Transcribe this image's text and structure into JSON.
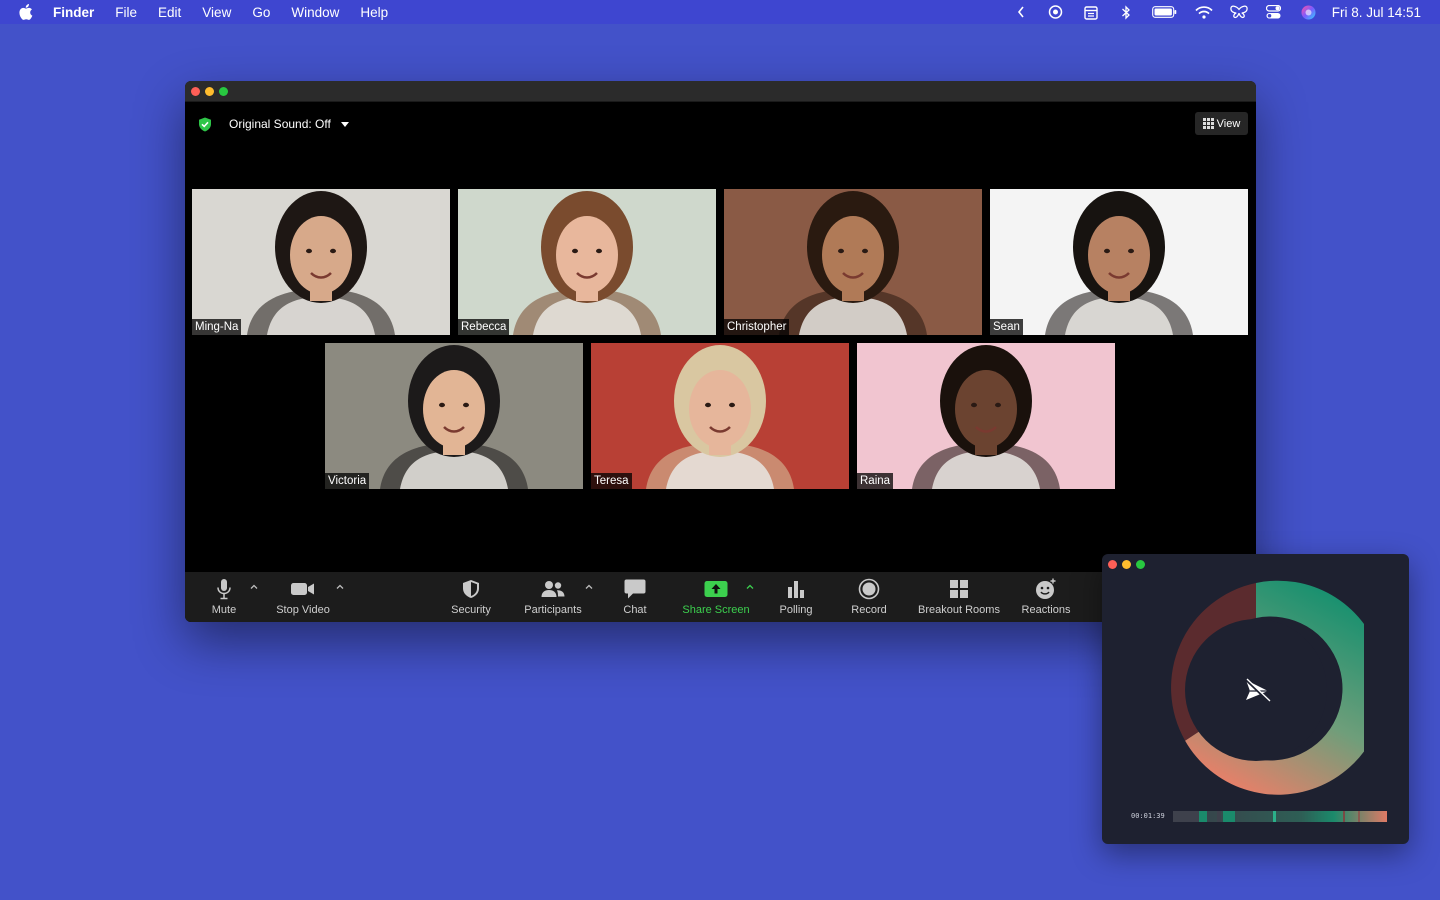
{
  "menubar": {
    "app_name": "Finder",
    "items": [
      "File",
      "Edit",
      "View",
      "Go",
      "Window",
      "Help"
    ],
    "status_icons": [
      "chevron-left-icon",
      "eye-icon",
      "calendar-icon",
      "bluetooth-icon",
      "battery-icon",
      "wifi-icon",
      "butterfly-icon",
      "control-center-icon",
      "siri-icon"
    ],
    "clock": "Fri 8. Jul  14:51"
  },
  "zoom": {
    "original_sound": "Original Sound: Off",
    "view_label": "View",
    "participants": [
      {
        "name": "Ming-Na",
        "bg": "#d9d7d2",
        "skin": "#d7a98a",
        "hair": "#1e1714"
      },
      {
        "name": "Rebecca",
        "bg": "#cfd8cc",
        "skin": "#e8b79c",
        "hair": "#7a4b2e"
      },
      {
        "name": "Christopher",
        "bg": "#8a5a45",
        "skin": "#b07a57",
        "hair": "#2a1a10"
      },
      {
        "name": "Sean",
        "bg": "#f4f4f4",
        "skin": "#b78162",
        "hair": "#171310"
      },
      {
        "name": "Victoria",
        "bg": "#8c8a80",
        "skin": "#e2b595",
        "hair": "#1c1a1a"
      },
      {
        "name": "Teresa",
        "bg": "#b84035",
        "skin": "#e6b69b",
        "hair": "#d9c7a1"
      },
      {
        "name": "Raina",
        "bg": "#f1c5d0",
        "skin": "#6b4330",
        "hair": "#1a110c"
      }
    ],
    "toolbar": {
      "mute": "Mute",
      "stop_video": "Stop Video",
      "security": "Security",
      "participants": "Participants",
      "chat": "Chat",
      "share_screen": "Share Screen",
      "polling": "Polling",
      "record": "Record",
      "breakout_rooms": "Breakout Rooms",
      "reactions": "Reactions"
    }
  },
  "recorder": {
    "elapsed": "00:01:39",
    "colors": {
      "green": "#0f8f6e",
      "coral": "#ee7e68",
      "dark": "#5b2b2e"
    }
  }
}
